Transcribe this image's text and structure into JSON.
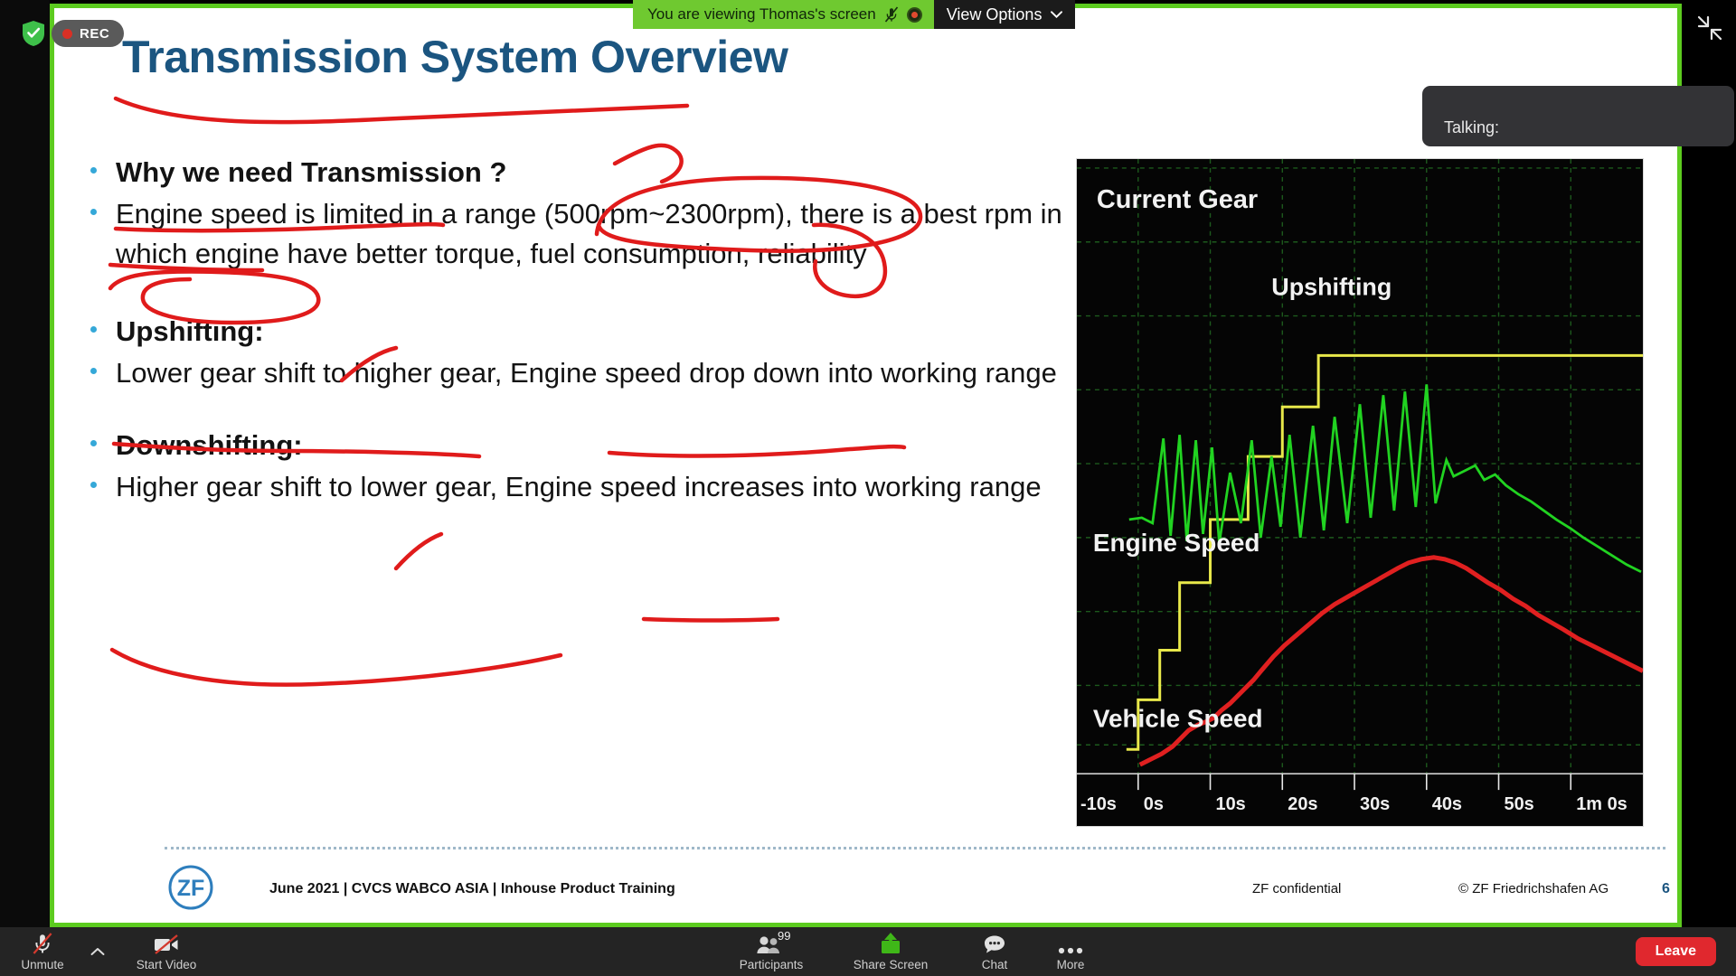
{
  "meeting": {
    "rec_label": "REC",
    "viewing_text": "You are viewing Thomas's screen",
    "view_options_label": "View Options",
    "talking_label": "Talking:",
    "shield_icon": "security-shield-icon",
    "exit_fullscreen_icon": "exit-fullscreen-icon"
  },
  "toolbar": {
    "unmute": {
      "label": "Unmute",
      "icon": "microphone-muted-icon"
    },
    "audio_caret": {
      "icon": "chevron-up-icon"
    },
    "video": {
      "label": "Start Video",
      "icon": "video-off-icon"
    },
    "participants": {
      "label": "Participants",
      "count": "99",
      "icon": "participants-icon"
    },
    "share": {
      "label": "Share Screen",
      "icon": "share-screen-icon"
    },
    "chat": {
      "label": "Chat",
      "icon": "chat-bubble-icon"
    },
    "more": {
      "label": "More",
      "icon": "ellipsis-icon"
    },
    "leave": {
      "label": "Leave"
    }
  },
  "slide": {
    "title": "Transmission System Overview",
    "bullets": [
      {
        "text": "Why we need Transmission ?",
        "bold": true
      },
      {
        "text": "Engine speed is limited in a range (500rpm~2300rpm), there is a best rpm in which engine have better torque, fuel consumption, reliability",
        "bold": false
      },
      {
        "text": "Upshifting:",
        "bold": true
      },
      {
        "text": "Lower gear shift to higher gear, Engine speed drop down into working range",
        "bold": false
      },
      {
        "text": "Downshifting:",
        "bold": true
      },
      {
        "text": "Higher gear shift to lower gear, Engine speed increases into working range",
        "bold": false
      }
    ],
    "footer": {
      "left": "June 2021 | CVCS WABCO ASIA | Inhouse Product Training",
      "confidential": "ZF confidential",
      "copyright": "© ZF Friedrichshafen AG",
      "page": "6",
      "logo": "zf-logo"
    },
    "colors": {
      "title_blue": "#1b5580",
      "bullet_blue": "#35a8d8",
      "ink_red": "#e01b1b",
      "share_green": "#5ccb1f"
    }
  },
  "chart_data": {
    "type": "line",
    "title": "",
    "background": "#050505",
    "grid": true,
    "grid_color": "#1f5e1f",
    "xlabel": "",
    "ylabel": "",
    "x_tick_labels": [
      "-10s",
      "0s",
      "10s",
      "20s",
      "30s",
      "40s",
      "50s",
      "1m 0s"
    ],
    "x_tick_values": [
      -10,
      0,
      10,
      20,
      30,
      40,
      50,
      60
    ],
    "xlim": [
      -13,
      63
    ],
    "annotations": [
      {
        "text": "Current Gear",
        "color": "#ffffff"
      },
      {
        "text": "Upshifting",
        "color": "#ffffff"
      },
      {
        "text": "Engine Speed",
        "color": "#ffffff"
      },
      {
        "text": "Vehicle Speed",
        "color": "#ffffff"
      }
    ],
    "series": [
      {
        "name": "Current Gear",
        "color": "#e8e84a",
        "style": "step",
        "x": [
          -10,
          -1,
          -1,
          2,
          2,
          5,
          5,
          10,
          10,
          17,
          17,
          24,
          24,
          31,
          31,
          60
        ],
        "y": [
          11,
          11,
          16,
          16,
          22,
          22,
          31,
          31,
          39,
          39,
          48,
          48,
          56,
          56,
          65,
          65
        ]
      },
      {
        "name": "Engine Speed",
        "color": "#21d321",
        "style": "sawtooth",
        "x": [
          -10,
          -5,
          -2,
          0,
          1,
          2,
          3,
          4,
          5,
          6,
          7,
          9,
          11,
          13,
          15,
          17,
          19,
          21,
          24,
          26,
          29,
          31,
          34,
          36,
          39,
          41,
          44,
          47,
          50,
          54,
          57,
          60
        ],
        "y": [
          45,
          45,
          46,
          62,
          44,
          63,
          43,
          62,
          44,
          61,
          43,
          58,
          46,
          62,
          44,
          60,
          47,
          63,
          48,
          66,
          50,
          68,
          54,
          70,
          56,
          54,
          52,
          55,
          50,
          47,
          44,
          41
        ]
      },
      {
        "name": "Vehicle Speed",
        "color": "#e02020",
        "style": "line",
        "x": [
          -1,
          1,
          3,
          5,
          7,
          9,
          11,
          13,
          16,
          19,
          22,
          25,
          28,
          31,
          34,
          37,
          40,
          43,
          46,
          49,
          52,
          55,
          58,
          60
        ],
        "y": [
          4,
          5,
          6,
          7,
          8,
          10,
          11,
          12,
          14,
          17,
          20,
          23,
          26,
          29,
          32,
          34,
          35,
          35,
          34,
          32,
          30,
          28,
          26,
          25
        ]
      }
    ]
  }
}
